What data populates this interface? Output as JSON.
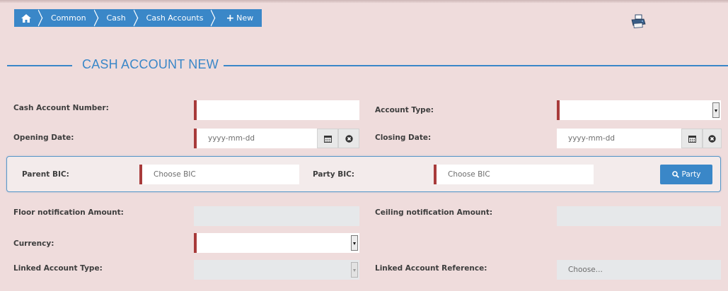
{
  "breadcrumb": {
    "items": [
      {
        "label": ""
      },
      {
        "label": "Common"
      },
      {
        "label": "Cash"
      },
      {
        "label": "Cash Accounts"
      },
      {
        "label": "New"
      }
    ],
    "new_prefix": "+"
  },
  "page_title": "CASH ACCOUNT NEW",
  "form": {
    "cash_account_number": {
      "label": "Cash Account Number:",
      "value": ""
    },
    "account_type": {
      "label": "Account Type:",
      "value": ""
    },
    "opening_date": {
      "label": "Opening Date:",
      "placeholder": "yyyy-mm-dd"
    },
    "closing_date": {
      "label": "Closing Date:",
      "placeholder": "yyyy-mm-dd"
    },
    "parent_bic": {
      "label": "Parent BIC:",
      "placeholder": "Choose BIC"
    },
    "party_bic": {
      "label": "Party BIC:",
      "placeholder": "Choose BIC"
    },
    "party_button": {
      "label": "Party",
      "icon": "search-icon"
    },
    "floor_notification": {
      "label": "Floor notification Amount:",
      "value": ""
    },
    "ceiling_notification": {
      "label": "Ceiling notification Amount:",
      "value": ""
    },
    "currency": {
      "label": "Currency:",
      "value": ""
    },
    "linked_account_type": {
      "label": "Linked Account Type:",
      "value": ""
    },
    "linked_account_reference": {
      "label": "Linked Account Reference:",
      "placeholder": "Choose..."
    }
  },
  "colors": {
    "accent": "#3a87c8",
    "required_marker": "#a83b3b",
    "background": "#efdcdc"
  }
}
